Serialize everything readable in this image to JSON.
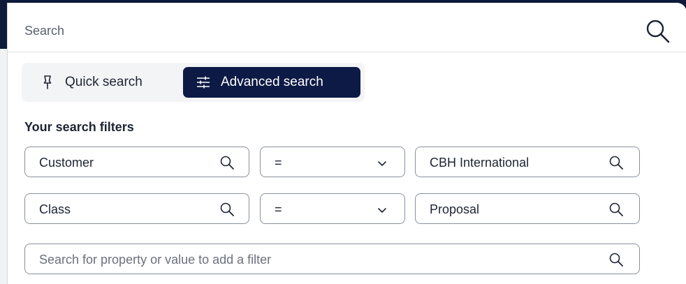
{
  "search": {
    "placeholder": "Search"
  },
  "mode_toggle": {
    "quick_label": "Quick search",
    "advanced_label": "Advanced search",
    "active": "Advanced search"
  },
  "filters": {
    "heading": "Your search filters",
    "rows": [
      {
        "property": "Customer",
        "operator": "=",
        "value": "CBH International"
      },
      {
        "property": "Class",
        "operator": "=",
        "value": "Proposal"
      }
    ],
    "add_filter_placeholder": "Search for property or value to add a filter"
  },
  "icons": {
    "search": "search-icon",
    "quick": "pin-icon",
    "advanced": "sliders-icon",
    "dropdown": "chevron-down-icon"
  },
  "colors": {
    "accent": "#0d1a45",
    "border": "#8a909c",
    "toggle_bg": "#f3f4f6"
  }
}
